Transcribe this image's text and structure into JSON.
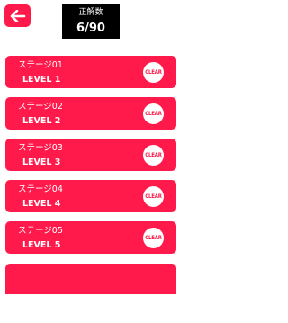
{
  "header": {
    "back_icon": "back-arrow-icon",
    "score_label": "正解数",
    "score_value": "6/90"
  },
  "stages": [
    {
      "name": "ステージ01",
      "level": "LEVEL 1",
      "status": "CLEAR"
    },
    {
      "name": "ステージ02",
      "level": "LEVEL 2",
      "status": "CLEAR"
    },
    {
      "name": "ステージ03",
      "level": "LEVEL 3",
      "status": "CLEAR"
    },
    {
      "name": "ステージ04",
      "level": "LEVEL 4",
      "status": "CLEAR"
    },
    {
      "name": "ステージ05",
      "level": "LEVEL 5",
      "status": "CLEAR"
    }
  ],
  "colors": {
    "accent": "#ff1a4b",
    "score_bg": "#000000",
    "background": "#ffffff"
  }
}
